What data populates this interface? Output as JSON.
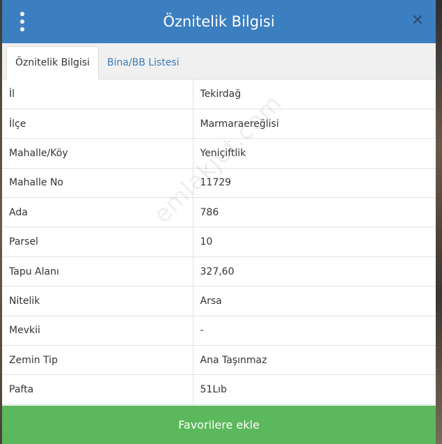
{
  "header": {
    "title": "Öznitelik Bilgisi",
    "menu_icon": "vertical-ellipsis-icon",
    "close_icon": "close-icon"
  },
  "tabs": [
    {
      "label": "Öznitelik Bilgisi",
      "active": true
    },
    {
      "label": "Bina/BB Listesi",
      "active": false
    }
  ],
  "rows": [
    {
      "key": "İl",
      "value": "Tekirdağ"
    },
    {
      "key": "İlçe",
      "value": "Marmaraereğlisi"
    },
    {
      "key": "Mahalle/Köy",
      "value": "Yeniçiftlik"
    },
    {
      "key": "Mahalle No",
      "value": "11729"
    },
    {
      "key": "Ada",
      "value": "786"
    },
    {
      "key": "Parsel",
      "value": "10"
    },
    {
      "key": "Tapu Alanı",
      "value": "327,60"
    },
    {
      "key": "Nitelik",
      "value": "Arsa"
    },
    {
      "key": "Mevkii",
      "value": "-"
    },
    {
      "key": "Zemin Tip",
      "value": "Ana Taşınmaz"
    },
    {
      "key": "Pafta",
      "value": "51Lıb"
    }
  ],
  "footer": {
    "button_label": "Favorilere ekle"
  },
  "watermark": "emlakjet.com",
  "colors": {
    "header_bg": "#3c7fc0",
    "button_bg": "#5cb85c",
    "tab_link": "#3a7ab8"
  }
}
